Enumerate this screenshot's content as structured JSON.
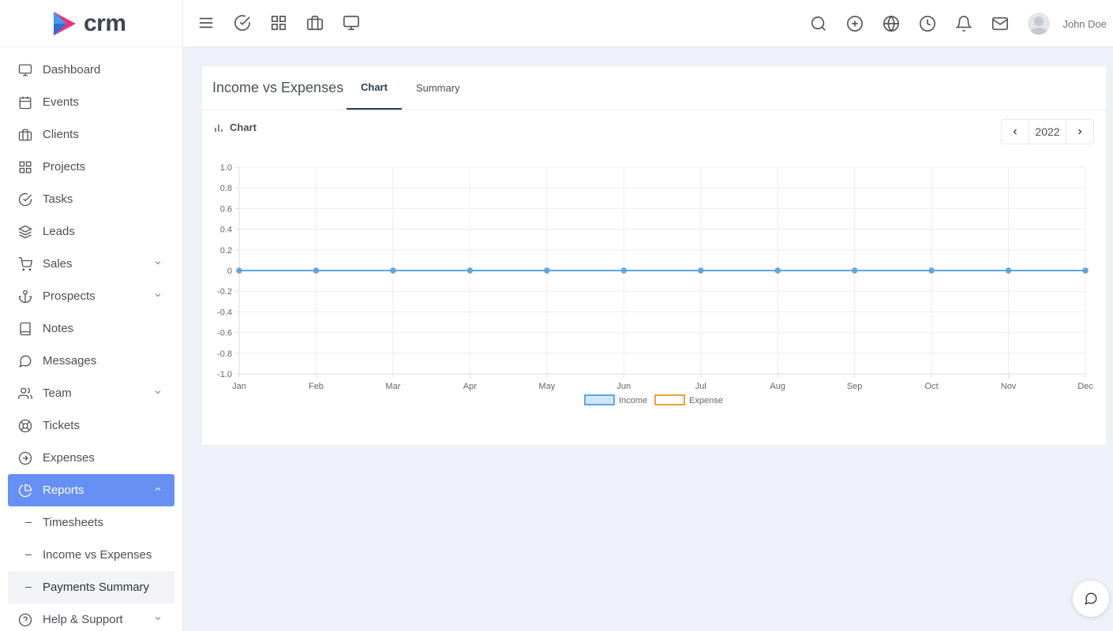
{
  "brand": {
    "name": "crm"
  },
  "sidebar": {
    "items": [
      {
        "label": "Dashboard",
        "icon": "monitor-icon"
      },
      {
        "label": "Events",
        "icon": "calendar-icon"
      },
      {
        "label": "Clients",
        "icon": "briefcase-icon"
      },
      {
        "label": "Projects",
        "icon": "grid-icon"
      },
      {
        "label": "Tasks",
        "icon": "check-circle-icon"
      },
      {
        "label": "Leads",
        "icon": "layers-icon"
      },
      {
        "label": "Sales",
        "icon": "cart-icon"
      },
      {
        "label": "Prospects",
        "icon": "anchor-icon"
      },
      {
        "label": "Notes",
        "icon": "book-icon"
      },
      {
        "label": "Messages",
        "icon": "message-icon"
      },
      {
        "label": "Team",
        "icon": "users-icon"
      },
      {
        "label": "Tickets",
        "icon": "lifebuoy-icon"
      },
      {
        "label": "Expenses",
        "icon": "arrow-circle-icon"
      },
      {
        "label": "Reports",
        "icon": "pie-chart-icon"
      }
    ],
    "sub_items": [
      {
        "label": "Timesheets"
      },
      {
        "label": "Income vs Expenses"
      },
      {
        "label": "Payments Summary"
      }
    ],
    "help": {
      "label": "Help & Support",
      "icon": "help-circle-icon"
    }
  },
  "topbar": {
    "user_name": "John Doe"
  },
  "card": {
    "title": "Income vs Expenses",
    "tabs": [
      {
        "label": "Chart"
      },
      {
        "label": "Summary"
      }
    ],
    "chart_heading": "Chart",
    "year": "2022"
  },
  "colors": {
    "accent": "#6690f4",
    "income": "#5ca8e0",
    "expense": "#f0a030"
  },
  "chart_data": {
    "type": "line",
    "categories": [
      "Jan",
      "Feb",
      "Mar",
      "Apr",
      "May",
      "Jun",
      "Jul",
      "Aug",
      "Sep",
      "Oct",
      "Nov",
      "Dec"
    ],
    "series": [
      {
        "name": "Income",
        "values": [
          0,
          0,
          0,
          0,
          0,
          0,
          0,
          0,
          0,
          0,
          0,
          0
        ],
        "color": "#5ca8e0"
      },
      {
        "name": "Expense",
        "values": [
          0,
          0,
          0,
          0,
          0,
          0,
          0,
          0,
          0,
          0,
          0,
          0
        ],
        "color": "#f0a030"
      }
    ],
    "ylim": [
      -1.0,
      1.0
    ],
    "yticks": [
      "1.0",
      "0.8",
      "0.6",
      "0.4",
      "0.2",
      "0",
      "-0.2",
      "-0.4",
      "-0.6",
      "-0.8",
      "-1.0"
    ],
    "ytick_values": [
      1.0,
      0.8,
      0.6,
      0.4,
      0.2,
      0,
      -0.2,
      -0.4,
      -0.6,
      -0.8,
      -1.0
    ],
    "grid": true,
    "legend": "bottom-center"
  }
}
